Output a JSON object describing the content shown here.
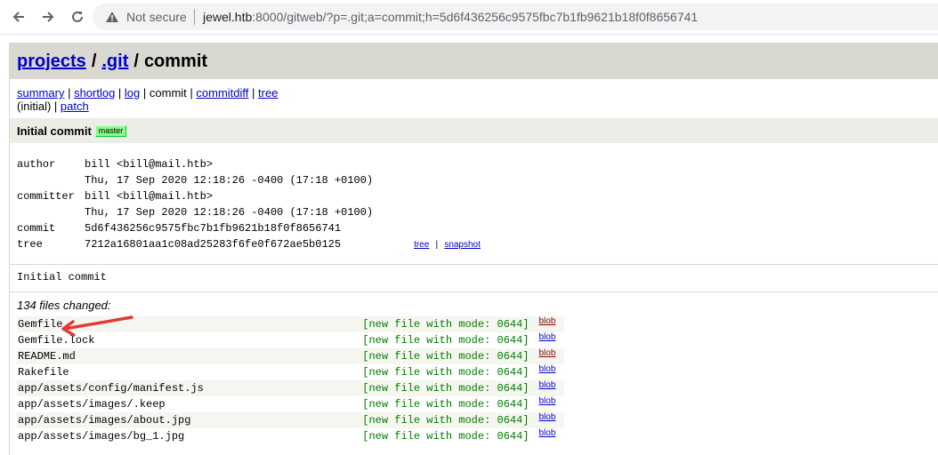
{
  "browser": {
    "security_label": "Not secure",
    "url_host": "jewel.htb",
    "url_rest": ":8000/gitweb/?p=.git;a=commit;h=5d6f436256c9575fbc7b1fb9621b18f0f8656741"
  },
  "header": {
    "projects": "projects",
    "separator": "/",
    "repo": ".git",
    "action": "commit"
  },
  "nav": {
    "summary": "summary",
    "sep": " | ",
    "shortlog": "shortlog",
    "log": "log",
    "commit": "commit",
    "commitdiff": "commitdiff",
    "tree": "tree",
    "initial": "(initial)",
    "patch": "patch"
  },
  "commit": {
    "title": "Initial commit",
    "ref": "master",
    "author_label": "author",
    "author": "bill <bill@mail.htb>",
    "author_date": "Thu, 17 Sep 2020 12:18:26 -0400 (17:18 +0100)",
    "committer_label": "committer",
    "committer": "bill <bill@mail.htb>",
    "committer_date": "Thu, 17 Sep 2020 12:18:26 -0400 (17:18 +0100)",
    "commit_label": "commit",
    "hash": "5d6f436256c9575fbc7b1fb9621b18f0f8656741",
    "tree_label": "tree",
    "tree_hash": "7212a16801aa1c08ad25283f6fe0f672ae5b0125",
    "tree_link": "tree",
    "snapshot_link": "snapshot",
    "link_sep": "|",
    "message": "Initial commit"
  },
  "files_changed": "134 files changed:",
  "files": [
    {
      "name": "Gemfile",
      "mode": "[new file with mode: 0644]",
      "link": "blob",
      "style": "changed"
    },
    {
      "name": "Gemfile.lock",
      "mode": "[new file with mode: 0644]",
      "link": "blob",
      "style": "normal"
    },
    {
      "name": "README.md",
      "mode": "[new file with mode: 0644]",
      "link": "blob",
      "style": "changed"
    },
    {
      "name": "Rakefile",
      "mode": "[new file with mode: 0644]",
      "link": "blob",
      "style": "normal"
    },
    {
      "name": "app/assets/config/manifest.js",
      "mode": "[new file with mode: 0644]",
      "link": "blob",
      "style": "normal"
    },
    {
      "name": "app/assets/images/.keep",
      "mode": "[new file with mode: 0644]",
      "link": "blob",
      "style": "normal"
    },
    {
      "name": "app/assets/images/about.jpg",
      "mode": "[new file with mode: 0644]",
      "link": "blob",
      "style": "normal"
    },
    {
      "name": "app/assets/images/bg_1.jpg",
      "mode": "[new file with mode: 0644]",
      "link": "blob",
      "style": "normal"
    }
  ],
  "colors": {
    "link": "#0000cc",
    "header_bg": "#d9d8d1",
    "mode_text": "#008000",
    "annotation_arrow": "#e53935"
  }
}
